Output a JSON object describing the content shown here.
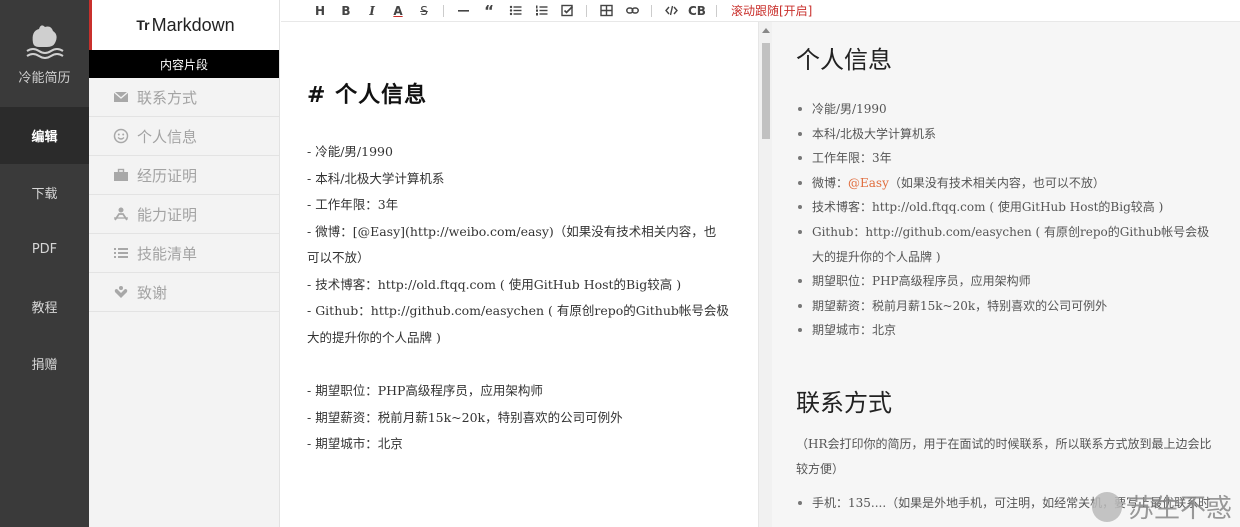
{
  "rail": {
    "brand_label": "冷能简历",
    "items": [
      {
        "label": "编辑",
        "active": true
      },
      {
        "label": "下载",
        "active": false
      },
      {
        "label": "PDF",
        "active": false
      },
      {
        "label": "教程",
        "active": false
      },
      {
        "label": "捐赠",
        "active": false
      }
    ]
  },
  "snippets": {
    "app_prefix": "Tr",
    "app_title": "Markdown",
    "section_title": "内容片段",
    "items": [
      {
        "label": "联系方式",
        "icon": "envelope-icon"
      },
      {
        "label": "个人信息",
        "icon": "smiley-icon"
      },
      {
        "label": "经历证明",
        "icon": "briefcase-icon"
      },
      {
        "label": "能力证明",
        "icon": "person-icon"
      },
      {
        "label": "技能清单",
        "icon": "list-icon"
      },
      {
        "label": "致谢",
        "icon": "thanks-icon"
      }
    ]
  },
  "toolbar": {
    "heading": "H",
    "bold": "B",
    "italic": "I",
    "color": "A",
    "strike": "S",
    "quote": "“",
    "code_block": "CB",
    "scroll_sync": "滚动跟随[开启]"
  },
  "editor": {
    "heading": "# 个人信息",
    "lines": [
      "- 冷能/男/1990",
      "- 本科/北极大学计算机系",
      "- 工作年限：3年",
      "- 微博：[@Easy](http://weibo.com/easy)（如果没有技术相关内容，也",
      "可以不放）",
      "- 技术博客：http://old.ftqq.com ( 使用GitHub Host的Big较高 )",
      "- Github：http://github.com/easychen ( 有原创repo的Github帐号会极",
      "大的提升你的个人品牌 )",
      "",
      "- 期望职位：PHP高级程序员，应用架构师",
      "- 期望薪资：税前月薪15k~20k，特别喜欢的公司可例外",
      "- 期望城市：北京"
    ],
    "weibo_link_text": "[@Easy]"
  },
  "preview": {
    "heading1": "个人信息",
    "items": [
      "冷能/男/1990",
      "本科/北极大学计算机系",
      "工作年限：3年",
      "技术博客：http://old.ftqq.com ( 使用GitHub Host的Big较高 )",
      "Github：http://github.com/easychen ( 有原创repo的Github帐号会极大的提升你的个人品牌 )",
      "期望职位：PHP高级程序员，应用架构师",
      "期望薪资：税前月薪15k~20k，特别喜欢的公司可例外",
      "期望城市：北京"
    ],
    "weibo_prefix": "微博：",
    "weibo_at": "@Easy",
    "weibo_suffix": "（如果没有技术相关内容，也可以不放）",
    "heading2": "联系方式",
    "contact_para": "（HR会打印你的简历，用于在面试的时候联系，所以联系方式放到最上边会比较方便）",
    "contact_item": "手机：135....（如果是外地手机，可注明，如经常关机，要写上最优联系时",
    "accent_color": "#e06c3c"
  },
  "watermark_text": "苏生不惑"
}
